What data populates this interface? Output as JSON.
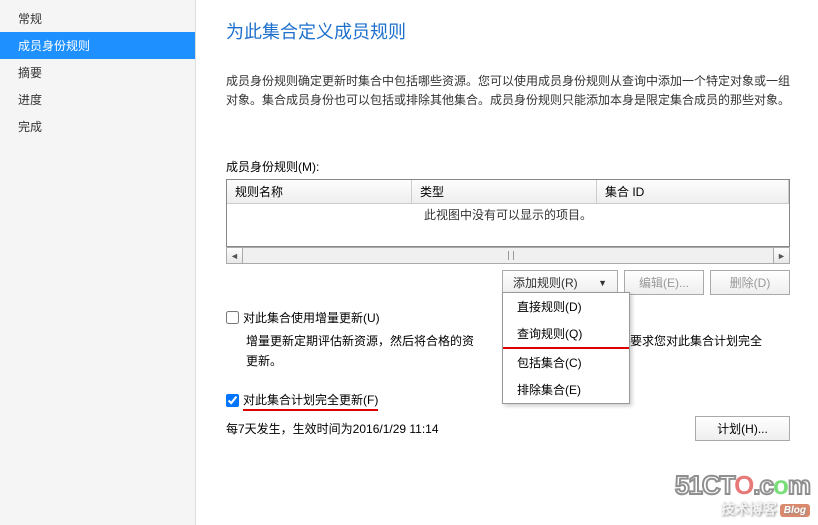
{
  "sidebar": {
    "items": [
      {
        "label": "常规"
      },
      {
        "label": "成员身份规则"
      },
      {
        "label": "摘要"
      },
      {
        "label": "进度"
      },
      {
        "label": "完成"
      }
    ]
  },
  "main": {
    "title": "为此集合定义成员规则",
    "description": "成员身份规则确定更新时集合中包括哪些资源。您可以使用成员身份规则从查询中添加一个特定对象或一组对象。集合成员身份也可以包括或排除其他集合。成员身份规则只能添加本身是限定集合成员的那些对象。",
    "rules_label": "成员身份规则(M):",
    "table": {
      "headers": [
        "规则名称",
        "类型",
        "集合 ID"
      ],
      "empty_text": "此视图中没有可以显示的项目。"
    },
    "buttons": {
      "add_rule": "添加规则(R)",
      "edit": "编辑(E)...",
      "delete": "删除(D)"
    },
    "dropdown": {
      "items": [
        {
          "label": "直接规则(D)"
        },
        {
          "label": "查询规则(Q)"
        },
        {
          "label": "包括集合(C)"
        },
        {
          "label": "排除集合(E)"
        }
      ]
    },
    "incremental": {
      "checkbox_label": "对此集合使用增量更新(U)",
      "desc_prefix": "增量更新定期评估新资源，然后将合格的资",
      "desc_suffix": "顶不要求您对此集合计划完全更新。"
    },
    "full_update": {
      "checkbox_label": "对此集合计划完全更新(F)",
      "schedule_text": "每7天发生，生效时间为2016/1/29 11:14",
      "plan_button": "计划(H)..."
    }
  },
  "watermark": {
    "brand": "51CTO.com",
    "sub": "技术博客",
    "badge": "Blog"
  }
}
